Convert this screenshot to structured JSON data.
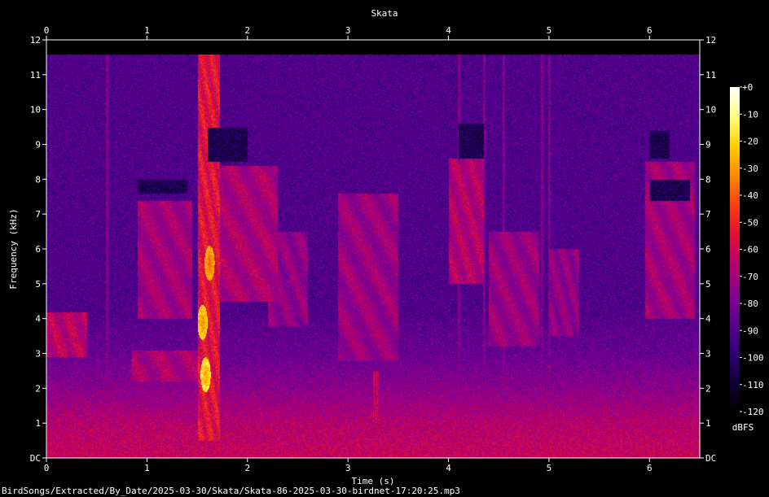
{
  "chart_data": {
    "type": "heatmap",
    "title": "Skata",
    "xlabel": "Time (s)",
    "ylabel": "Frequency (kHz)",
    "xlim": [
      0,
      6.5
    ],
    "ylim": [
      0,
      12
    ],
    "x_ticks": [
      "0",
      "1",
      "2",
      "3",
      "4",
      "5",
      "6"
    ],
    "x_tick_values": [
      0,
      1,
      2,
      3,
      4,
      5,
      6
    ],
    "y_ticks": [
      "DC",
      "1",
      "2",
      "3",
      "4",
      "5",
      "6",
      "7",
      "8",
      "9",
      "10",
      "11",
      "12"
    ],
    "y_tick_values": [
      0,
      1,
      2,
      3,
      4,
      5,
      6,
      7,
      8,
      9,
      10,
      11,
      12
    ],
    "colorbar": {
      "label": "dBFS",
      "ticks": [
        "+0",
        "-10",
        "-20",
        "-30",
        "-40",
        "-50",
        "-60",
        "-70",
        "-80",
        "-90",
        "-100",
        "-110",
        "-120"
      ],
      "tick_values": [
        0,
        -10,
        -20,
        -30,
        -40,
        -50,
        -60,
        -70,
        -80,
        -90,
        -100,
        -110,
        -120
      ],
      "range": [
        -120,
        0
      ]
    },
    "colormap": [
      "#000000",
      "#10003a",
      "#30007a",
      "#5a0090",
      "#8a0090",
      "#b8006a",
      "#e0103a",
      "#f84010",
      "#ff8800",
      "#ffd000",
      "#ffff80",
      "#ffffff"
    ],
    "energy_max_freq_khz": 11.6,
    "background_level_db": -90,
    "low_band": [
      {
        "freq_khz": 0,
        "level_db": -62
      },
      {
        "freq_khz": 1,
        "level_db": -66
      },
      {
        "freq_khz": 2,
        "level_db": -76
      },
      {
        "freq_khz": 3,
        "level_db": -84
      },
      {
        "freq_khz": 4,
        "level_db": -88
      }
    ],
    "events": [
      {
        "t_start": 1.5,
        "t_end": 1.72,
        "f_low": 0.5,
        "f_high": 11.6,
        "level_db": -50
      },
      {
        "t_start": 0.0,
        "t_end": 0.4,
        "f_low": 2.9,
        "f_high": 4.2,
        "level_db": -60
      },
      {
        "t_start": 0.85,
        "t_end": 1.5,
        "f_low": 2.2,
        "f_high": 3.1,
        "level_db": -64
      },
      {
        "t_start": 0.9,
        "t_end": 1.45,
        "f_low": 4.0,
        "f_high": 7.4,
        "level_db": -66
      },
      {
        "t_start": 1.7,
        "t_end": 2.3,
        "f_low": 4.5,
        "f_high": 8.4,
        "level_db": -64
      },
      {
        "t_start": 2.2,
        "t_end": 2.6,
        "f_low": 3.8,
        "f_high": 6.5,
        "level_db": -70
      },
      {
        "t_start": 2.9,
        "t_end": 3.5,
        "f_low": 2.8,
        "f_high": 7.6,
        "level_db": -68
      },
      {
        "t_start": 3.25,
        "t_end": 3.3,
        "f_low": 1.0,
        "f_high": 2.5,
        "level_db": -58
      },
      {
        "t_start": 4.0,
        "t_end": 4.35,
        "f_low": 5.0,
        "f_high": 8.6,
        "level_db": -62
      },
      {
        "t_start": 4.4,
        "t_end": 4.9,
        "f_low": 3.2,
        "f_high": 6.5,
        "level_db": -68
      },
      {
        "t_start": 5.0,
        "t_end": 5.3,
        "f_low": 3.5,
        "f_high": 6.0,
        "level_db": -70
      },
      {
        "t_start": 5.95,
        "t_end": 6.45,
        "f_low": 4.0,
        "f_high": 8.5,
        "level_db": -66
      }
    ],
    "dark_gaps": [
      {
        "t_start": 0.9,
        "t_end": 1.4,
        "f_low": 7.6,
        "f_high": 8.0
      },
      {
        "t_start": 1.6,
        "t_end": 2.0,
        "f_low": 8.5,
        "f_high": 9.5
      },
      {
        "t_start": 4.1,
        "t_end": 4.35,
        "f_low": 8.6,
        "f_high": 9.6
      },
      {
        "t_start": 6.0,
        "t_end": 6.4,
        "f_low": 7.4,
        "f_high": 8.0
      },
      {
        "t_start": 6.0,
        "t_end": 6.2,
        "f_low": 8.6,
        "f_high": 9.4
      }
    ],
    "clicks": [
      0.6,
      1.62,
      4.1,
      4.35,
      4.55,
      4.93,
      5.0
    ],
    "hot_spots": [
      {
        "t": 1.58,
        "f_khz": 2.4,
        "level_db": -30
      },
      {
        "t": 1.55,
        "f_khz": 3.9,
        "level_db": -34
      },
      {
        "t": 1.62,
        "f_khz": 5.6,
        "level_db": -40
      }
    ]
  },
  "footer": {
    "path": "BirdSongs/Extracted/By_Date/2025-03-30/Skata/Skata-86-2025-03-30-birdnet-17:20:25.mp3"
  }
}
